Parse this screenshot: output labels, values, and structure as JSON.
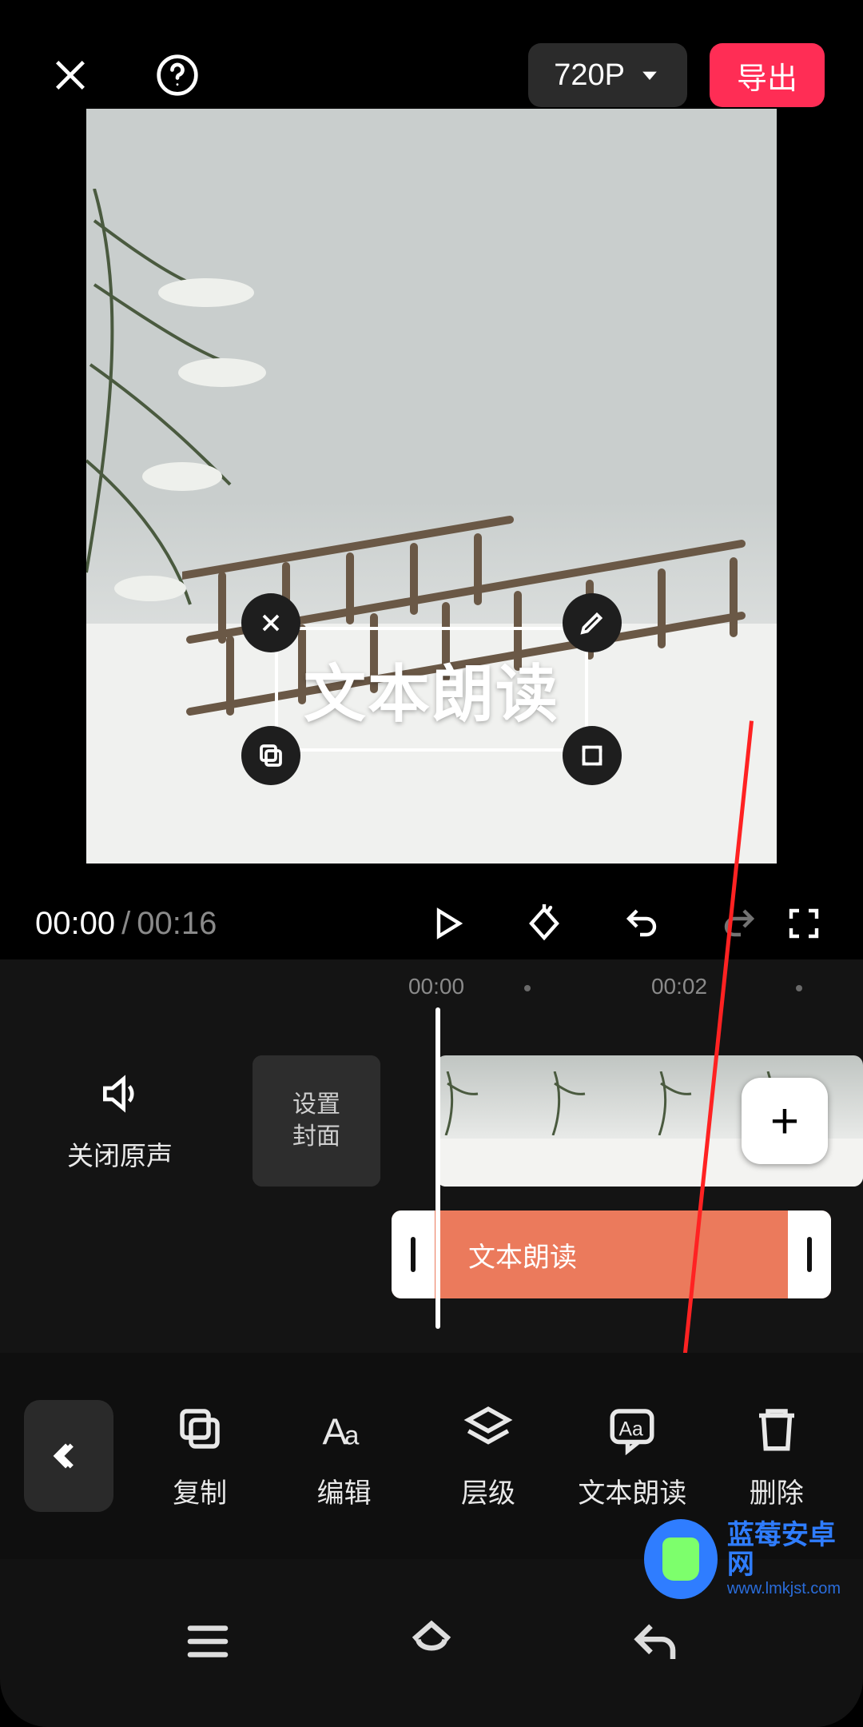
{
  "header": {
    "resolution_label": "720P",
    "export_label": "导出"
  },
  "preview": {
    "text_overlay": "文本朗读"
  },
  "player": {
    "current_time": "00:00",
    "total_time": "00:16"
  },
  "timeline": {
    "ruler_labels": [
      "00:00",
      "00:02"
    ],
    "mute_label": "关闭原声",
    "cover_line1": "设置",
    "cover_line2": "封面",
    "text_track_label": "文本朗读"
  },
  "toolbar": {
    "items": [
      {
        "name": "copy",
        "label": "复制"
      },
      {
        "name": "edit",
        "label": "编辑"
      },
      {
        "name": "layer",
        "label": "层级"
      },
      {
        "name": "tts",
        "label": "文本朗读"
      },
      {
        "name": "delete",
        "label": "删除"
      }
    ]
  },
  "watermark": {
    "line1": "蓝莓安卓网",
    "line2": "www.lmkjst.com"
  }
}
